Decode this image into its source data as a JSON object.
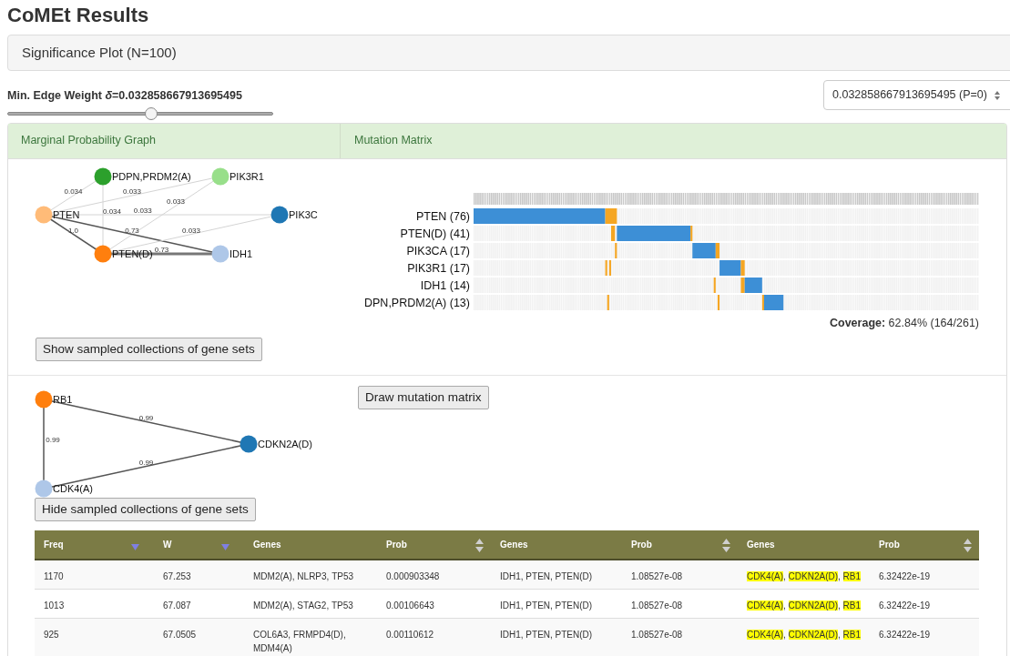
{
  "title": "CoMEt Results",
  "significance_panel": {
    "label": "Significance Plot (N=100)"
  },
  "edge_weight": {
    "label": "Min. Edge Weight *δ*=0.032858667913695495",
    "level": 0.54
  },
  "weight_select": {
    "value": "0.032858667913695495 (P=0)"
  },
  "panels": [
    "Marginal Probability Graph",
    "Mutation Matrix"
  ],
  "graph": {
    "nodes": [
      {
        "name": "PTEN",
        "color": "#ffbb78"
      },
      {
        "name": "PDPN,PRDM2(A)",
        "color": "#2ca02c"
      },
      {
        "name": "PIK3R1",
        "color": "#98df8a"
      },
      {
        "name": "PIK3C",
        "color": "#1f77b4"
      },
      {
        "name": "PTEN(D)",
        "color": "#ff7f0e"
      },
      {
        "name": "IDH1",
        "color": "#aec7e8"
      }
    ],
    "edges": [
      {
        "label": "0.034",
        "kind": "weak"
      },
      {
        "label": "0.033",
        "kind": "weak"
      },
      {
        "label": "0.034",
        "kind": "weak"
      },
      {
        "label": "0.033",
        "kind": "weak"
      },
      {
        "label": "0.033",
        "kind": "weak"
      },
      {
        "label": "1.0",
        "kind": "strong"
      },
      {
        "label": "0.73",
        "kind": "strong"
      },
      {
        "label": "0.033",
        "kind": "weak"
      },
      {
        "label": "0.73",
        "kind": "thick"
      }
    ]
  },
  "matrix": {
    "rows": [
      "PTEN (76)",
      "PTEN(D) (41)",
      "PIK3CA (17)",
      "PIK3R1 (17)",
      "IDH1 (14)",
      "DPN,PRDM2(A) (13)"
    ],
    "coverage": "**Coverage:** 62.84% (164/261)"
  },
  "show_button": "Show sampled collections of gene sets",
  "draw_button": "Draw mutation matrix",
  "graph2": {
    "nodes": [
      {
        "name": "RB1",
        "color": "#ff7f0e"
      },
      {
        "name": "CDKN2A(D)",
        "color": "#1f77b4"
      },
      {
        "name": "CDK4(A)",
        "color": "#aec7e8"
      }
    ],
    "edges": [
      {
        "label": "0.99",
        "kind": "strong"
      },
      {
        "label": "0.99",
        "kind": "strong"
      },
      {
        "label": "0.99",
        "kind": "strong"
      }
    ]
  },
  "hide_button": "Hide sampled collections of gene sets",
  "table": {
    "columns": [
      {
        "label": "Freq",
        "kind": "sorted"
      },
      {
        "label": "W",
        "kind": "sorted"
      },
      {
        "label": "Genes",
        "kind": "plain"
      },
      {
        "label": "Prob",
        "kind": "sortable"
      },
      {
        "label": "Genes",
        "kind": "plain"
      },
      {
        "label": "Prob",
        "kind": "sortable"
      },
      {
        "label": "Genes",
        "kind": "plain"
      },
      {
        "label": "Prob",
        "kind": "sortable"
      }
    ],
    "rows": [
      {
        "freq": "1170",
        "w": "67.253",
        "sets": [
          {
            "genes": [
              {
                "name": "MDM2(A)",
                "suffix": ",",
                "highlighted": false
              },
              {
                "name": "NLRP3",
                "suffix": ",",
                "highlighted": false
              },
              {
                "name": "TP53",
                "highlighted": false
              }
            ],
            "prob": "0.000903348"
          },
          {
            "genes": [
              {
                "name": "IDH1",
                "suffix": ",",
                "highlighted": false
              },
              {
                "name": "PTEN",
                "suffix": ",",
                "highlighted": false
              },
              {
                "name": "PTEN(D)",
                "highlighted": false
              }
            ],
            "prob": "1.08527e-08"
          },
          {
            "genes": [
              {
                "name": "CDK4(A)",
                "suffix": ",",
                "highlighted": true
              },
              {
                "name": "CDKN2A(D)",
                "suffix": ",",
                "highlighted": true
              },
              {
                "name": "RB1",
                "highlighted": true
              }
            ],
            "prob": "6.32422e-19"
          }
        ]
      },
      {
        "freq": "1013",
        "w": "67.087",
        "sets": [
          {
            "genes": [
              {
                "name": "MDM2(A)",
                "suffix": ",",
                "highlighted": false
              },
              {
                "name": "STAG2",
                "suffix": ",",
                "highlighted": false
              },
              {
                "name": "TP53",
                "highlighted": false
              }
            ],
            "prob": "0.00106643"
          },
          {
            "genes": [
              {
                "name": "IDH1",
                "suffix": ",",
                "highlighted": false
              },
              {
                "name": "PTEN",
                "suffix": ",",
                "highlighted": false
              },
              {
                "name": "PTEN(D)",
                "highlighted": false
              }
            ],
            "prob": "1.08527e-08"
          },
          {
            "genes": [
              {
                "name": "CDK4(A)",
                "suffix": ",",
                "highlighted": true
              },
              {
                "name": "CDKN2A(D)",
                "suffix": ",",
                "highlighted": true
              },
              {
                "name": "RB1",
                "highlighted": true
              }
            ],
            "prob": "6.32422e-19"
          }
        ]
      },
      {
        "freq": "925",
        "w": "67.0505",
        "sets": [
          {
            "genes": [
              {
                "name": "COL6A3",
                "suffix": ",",
                "highlighted": false
              },
              {
                "name": "FRMPD4(D)",
                "suffix": ",",
                "highlighted": false
              },
              {
                "name": "MDM4(A)",
                "highlighted": false
              }
            ],
            "prob": "0.00110612"
          },
          {
            "genes": [
              {
                "name": "IDH1",
                "suffix": ",",
                "highlighted": false
              },
              {
                "name": "PTEN",
                "suffix": ",",
                "highlighted": false
              },
              {
                "name": "PTEN(D)",
                "highlighted": false
              }
            ],
            "prob": "1.08527e-08"
          },
          {
            "genes": [
              {
                "name": "CDK4(A)",
                "suffix": ",",
                "highlighted": true
              },
              {
                "name": "CDKN2A(D)",
                "suffix": ",",
                "highlighted": true
              },
              {
                "name": "RB1",
                "highlighted": true
              }
            ],
            "prob": "6.32422e-19"
          }
        ]
      }
    ]
  }
}
